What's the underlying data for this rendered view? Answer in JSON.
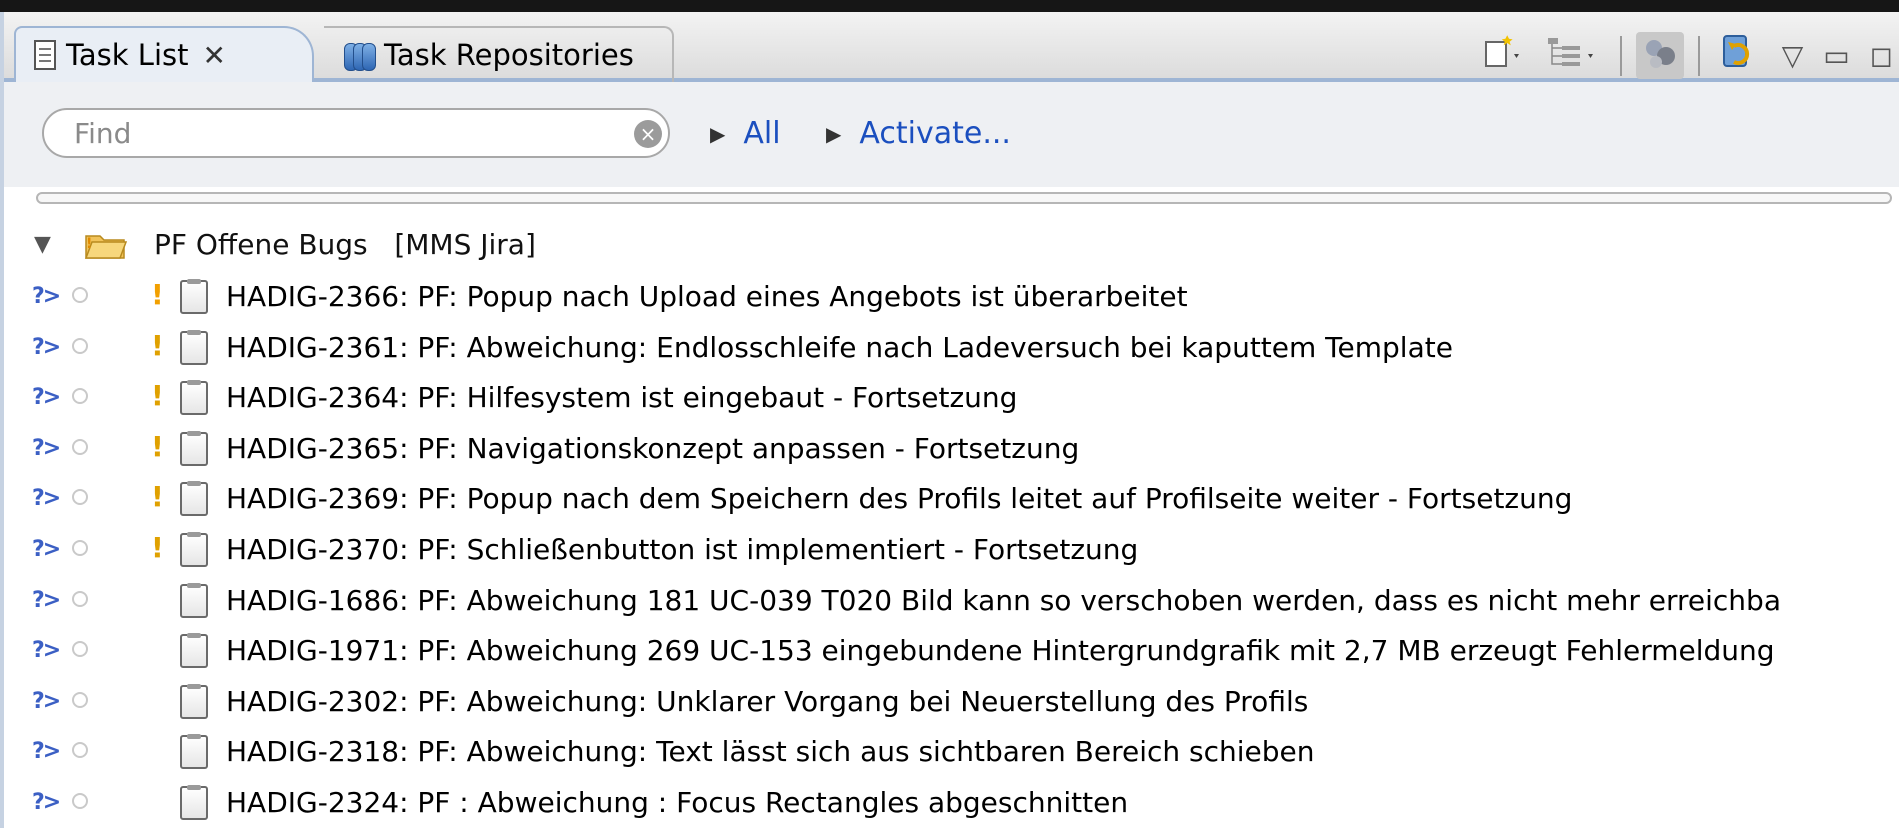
{
  "tabs": {
    "task_list": "Task List",
    "task_repositories": "Task Repositories",
    "close_glyph": "✕"
  },
  "filter": {
    "placeholder": "Find",
    "all_label": "All",
    "activate_label": "Activate..."
  },
  "category": {
    "name": "PF Offene Bugs",
    "repository": "[MMS Jira]"
  },
  "tasks": [
    {
      "text": "HADIG-2366: PF: Popup nach Upload eines Angebots ist überarbeitet",
      "priority": "high"
    },
    {
      "text": "HADIG-2361: PF: Abweichung: Endlosschleife nach Ladeversuch bei kaputtem Template",
      "priority": "medium"
    },
    {
      "text": "HADIG-2364: PF: Hilfesystem ist eingebaut - Fortsetzung",
      "priority": "medium"
    },
    {
      "text": "HADIG-2365: PF: Navigationskonzept anpassen - Fortsetzung",
      "priority": "medium"
    },
    {
      "text": "HADIG-2369: PF: Popup nach dem Speichern des Profils leitet auf Profilseite weiter - Fortsetzung",
      "priority": "medium"
    },
    {
      "text": "HADIG-2370: PF: Schließenbutton ist implementiert - Fortsetzung",
      "priority": "medium"
    },
    {
      "text": "HADIG-1686: PF: Abweichung 181 UC-039 T020 Bild kann so verschoben werden, dass es nicht mehr erreichba",
      "priority": "none"
    },
    {
      "text": "HADIG-1971: PF: Abweichung 269 UC-153 eingebundene Hintergrundgrafik mit 2,7 MB erzeugt Fehlermeldung",
      "priority": "none"
    },
    {
      "text": "HADIG-2302: PF: Abweichung: Unklarer Vorgang bei Neuerstellung des Profils",
      "priority": "none"
    },
    {
      "text": "HADIG-2318: PF: Abweichung: Text lässt sich aus sichtbaren Bereich schieben",
      "priority": "none"
    },
    {
      "text": "HADIG-2324: PF : Abweichung : Focus Rectangles abgeschnitten",
      "priority": "none"
    }
  ],
  "glyphs": {
    "sync": "?>",
    "priority_mark": "!",
    "clear": "×",
    "expand": "▼",
    "triangle": "▶",
    "view_menu": "▽",
    "minimize": "▭",
    "maximize": "◻",
    "dropdown": "▾"
  }
}
